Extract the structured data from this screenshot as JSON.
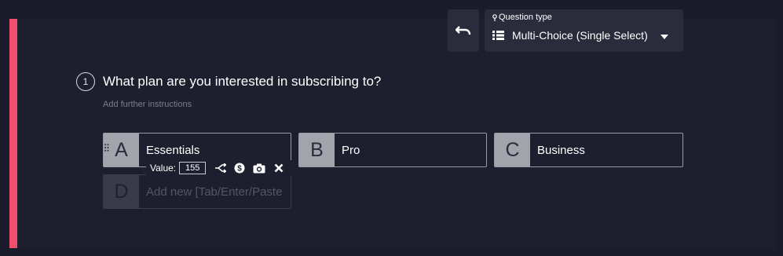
{
  "question_type": {
    "label": "Question type",
    "value": "Multi-Choice (Single Select)"
  },
  "question": {
    "number": "1",
    "title": "What plan are you interested in subscribing to?",
    "instructions_placeholder": "Add further instructions"
  },
  "options": [
    {
      "letter": "A",
      "label": "Essentials"
    },
    {
      "letter": "B",
      "label": "Pro"
    },
    {
      "letter": "C",
      "label": "Business"
    }
  ],
  "new_option": {
    "letter": "D",
    "placeholder": "Add new [Tab/Enter/Paste"
  },
  "value_toolbar": {
    "label": "Value:",
    "value": "155"
  },
  "colors": {
    "accent": "#f0506e",
    "background": "#1e1f2e",
    "panel": "#2b2c3b",
    "option_letter_bg": "#a3a3ab"
  },
  "icons": {
    "undo": "undo-icon",
    "pin": "pin-icon",
    "list": "list-icon",
    "caret": "caret-down-icon",
    "drag": "drag-handle-icon",
    "branch": "branch-icon",
    "price": "dollar-icon",
    "camera": "camera-icon",
    "delete": "close-icon"
  }
}
